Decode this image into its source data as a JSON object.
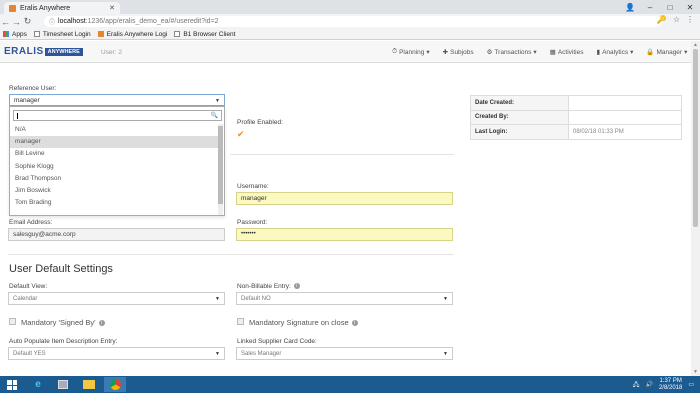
{
  "browser": {
    "tab_title": "Eralis Anywhere",
    "url_host": "localhost",
    "url_path": ":1236/app/eralis_demo_ea/#/useredit?id=2",
    "bookmarks": [
      {
        "label": "Apps",
        "icon": "apps-grid-icon"
      },
      {
        "label": "Timesheet Login",
        "icon": "page-icon"
      },
      {
        "label": "Eralis Anywhere Logi",
        "icon": "eralis-icon"
      },
      {
        "label": "B1 Browser Client",
        "icon": "page-icon"
      }
    ]
  },
  "app": {
    "logo_text": "ERALIS",
    "logo_sub": "ANYWHERE",
    "user_label": "User: 2",
    "nav": [
      {
        "label": "Planning",
        "icon": "clock-icon",
        "dropdown": true
      },
      {
        "label": "Subjobs",
        "icon": "pin-icon",
        "dropdown": false
      },
      {
        "label": "Transactions",
        "icon": "gear-icon",
        "dropdown": true
      },
      {
        "label": "Activities",
        "icon": "calendar-icon",
        "dropdown": false
      },
      {
        "label": "Analytics",
        "icon": "bar-chart-icon",
        "dropdown": true
      },
      {
        "label": "Manager",
        "icon": "lock-icon",
        "dropdown": true
      }
    ]
  },
  "form": {
    "reference_user_label": "Reference User:",
    "reference_user_value": "manager",
    "reference_options": [
      "N/A",
      "manager",
      "Bill Levine",
      "Sophie Klogg",
      "Brad Thompson",
      "Jim Boswick",
      "Tom Brading"
    ],
    "reference_selected_index": 1,
    "profile_enabled_label": "Profile Enabled:",
    "username_label": "Username:",
    "username_value": "manager",
    "email_label": "Email Address:",
    "email_value": "salesguy@acme.corp",
    "password_label": "Password:",
    "password_value": "•••••••"
  },
  "info_table": [
    {
      "key": "Date Created:",
      "value": ""
    },
    {
      "key": "Created By:",
      "value": ""
    },
    {
      "key": "Last Login:",
      "value": "08/02/18 01:33 PM"
    }
  ],
  "defaults": {
    "title": "User Default Settings",
    "default_view_label": "Default View:",
    "default_view_value": "Calendar",
    "non_billable_label": "Non-Billable Entry:",
    "non_billable_value": "Default NO",
    "mandatory_signed_by_label": "Mandatory 'Signed By'",
    "mandatory_signature_label": "Mandatory Signature on close",
    "auto_populate_label": "Auto Populate Item Description Entry:",
    "auto_populate_value": "Default YES",
    "linked_supplier_label": "Linked Supplier Card Code:",
    "linked_supplier_value": "Sales Manager"
  },
  "taskbar": {
    "time": "1:37 PM",
    "date": "2/8/2018"
  },
  "colors": {
    "brand": "#2f5597",
    "accent_check": "#f08a24",
    "highlight_field": "#fbf8c0",
    "taskbar": "#1c5b8f"
  }
}
